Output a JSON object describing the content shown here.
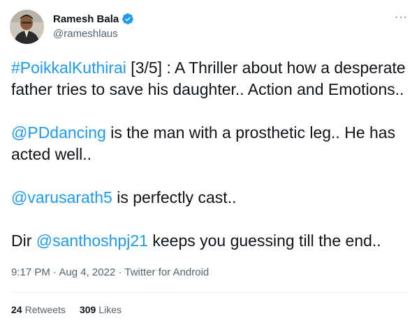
{
  "author": {
    "display_name": "Ramesh Bala",
    "handle": "@rameshlaus",
    "verified_color": "#1d9bf0"
  },
  "more_icon": "···",
  "tweet": {
    "p1": {
      "hashtag": "#PoikkalKuthirai",
      "text": " [3/5] : A Thriller about how a desperate father tries to save his daughter.. Action and Emotions.."
    },
    "p2": {
      "mention": "@PDdancing",
      "text": " is the man with a prosthetic leg.. He has acted well.."
    },
    "p3": {
      "mention": "@varusarath5",
      "text": " is perfectly cast.."
    },
    "p4": {
      "prefix": "Dir ",
      "mention": "@santhoshpj21",
      "text": " keeps you guessing till the end.."
    }
  },
  "meta": {
    "time": "9:17 PM",
    "separator": " · ",
    "date": "Aug 4, 2022",
    "source": "Twitter for Android"
  },
  "stats": {
    "retweets_count": "24",
    "retweets_label": "Retweets",
    "likes_count": "309",
    "likes_label": "Likes"
  },
  "colors": {
    "link": "#1d9bf0",
    "text": "#0f1419",
    "secondary": "#536471"
  }
}
